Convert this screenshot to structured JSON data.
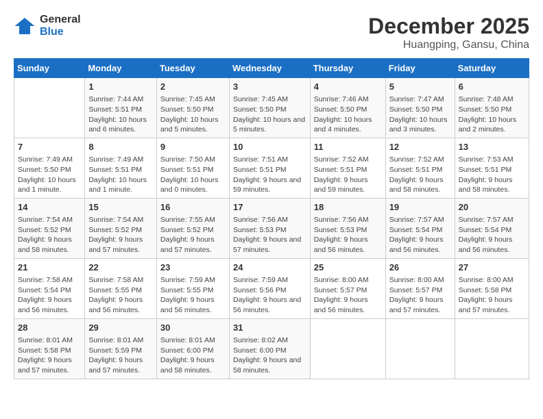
{
  "logo": {
    "general": "General",
    "blue": "Blue"
  },
  "title": {
    "month": "December 2025",
    "location": "Huangping, Gansu, China"
  },
  "days_of_week": [
    "Sunday",
    "Monday",
    "Tuesday",
    "Wednesday",
    "Thursday",
    "Friday",
    "Saturday"
  ],
  "weeks": [
    [
      {
        "day": "",
        "sunrise": "",
        "sunset": "",
        "daylight": ""
      },
      {
        "day": "1",
        "sunrise": "Sunrise: 7:44 AM",
        "sunset": "Sunset: 5:51 PM",
        "daylight": "Daylight: 10 hours and 6 minutes."
      },
      {
        "day": "2",
        "sunrise": "Sunrise: 7:45 AM",
        "sunset": "Sunset: 5:50 PM",
        "daylight": "Daylight: 10 hours and 5 minutes."
      },
      {
        "day": "3",
        "sunrise": "Sunrise: 7:45 AM",
        "sunset": "Sunset: 5:50 PM",
        "daylight": "Daylight: 10 hours and 5 minutes."
      },
      {
        "day": "4",
        "sunrise": "Sunrise: 7:46 AM",
        "sunset": "Sunset: 5:50 PM",
        "daylight": "Daylight: 10 hours and 4 minutes."
      },
      {
        "day": "5",
        "sunrise": "Sunrise: 7:47 AM",
        "sunset": "Sunset: 5:50 PM",
        "daylight": "Daylight: 10 hours and 3 minutes."
      },
      {
        "day": "6",
        "sunrise": "Sunrise: 7:48 AM",
        "sunset": "Sunset: 5:50 PM",
        "daylight": "Daylight: 10 hours and 2 minutes."
      }
    ],
    [
      {
        "day": "7",
        "sunrise": "Sunrise: 7:49 AM",
        "sunset": "Sunset: 5:50 PM",
        "daylight": "Daylight: 10 hours and 1 minute."
      },
      {
        "day": "8",
        "sunrise": "Sunrise: 7:49 AM",
        "sunset": "Sunset: 5:51 PM",
        "daylight": "Daylight: 10 hours and 1 minute."
      },
      {
        "day": "9",
        "sunrise": "Sunrise: 7:50 AM",
        "sunset": "Sunset: 5:51 PM",
        "daylight": "Daylight: 10 hours and 0 minutes."
      },
      {
        "day": "10",
        "sunrise": "Sunrise: 7:51 AM",
        "sunset": "Sunset: 5:51 PM",
        "daylight": "Daylight: 9 hours and 59 minutes."
      },
      {
        "day": "11",
        "sunrise": "Sunrise: 7:52 AM",
        "sunset": "Sunset: 5:51 PM",
        "daylight": "Daylight: 9 hours and 59 minutes."
      },
      {
        "day": "12",
        "sunrise": "Sunrise: 7:52 AM",
        "sunset": "Sunset: 5:51 PM",
        "daylight": "Daylight: 9 hours and 58 minutes."
      },
      {
        "day": "13",
        "sunrise": "Sunrise: 7:53 AM",
        "sunset": "Sunset: 5:51 PM",
        "daylight": "Daylight: 9 hours and 58 minutes."
      }
    ],
    [
      {
        "day": "14",
        "sunrise": "Sunrise: 7:54 AM",
        "sunset": "Sunset: 5:52 PM",
        "daylight": "Daylight: 9 hours and 58 minutes."
      },
      {
        "day": "15",
        "sunrise": "Sunrise: 7:54 AM",
        "sunset": "Sunset: 5:52 PM",
        "daylight": "Daylight: 9 hours and 57 minutes."
      },
      {
        "day": "16",
        "sunrise": "Sunrise: 7:55 AM",
        "sunset": "Sunset: 5:52 PM",
        "daylight": "Daylight: 9 hours and 57 minutes."
      },
      {
        "day": "17",
        "sunrise": "Sunrise: 7:56 AM",
        "sunset": "Sunset: 5:53 PM",
        "daylight": "Daylight: 9 hours and 57 minutes."
      },
      {
        "day": "18",
        "sunrise": "Sunrise: 7:56 AM",
        "sunset": "Sunset: 5:53 PM",
        "daylight": "Daylight: 9 hours and 56 minutes."
      },
      {
        "day": "19",
        "sunrise": "Sunrise: 7:57 AM",
        "sunset": "Sunset: 5:54 PM",
        "daylight": "Daylight: 9 hours and 56 minutes."
      },
      {
        "day": "20",
        "sunrise": "Sunrise: 7:57 AM",
        "sunset": "Sunset: 5:54 PM",
        "daylight": "Daylight: 9 hours and 56 minutes."
      }
    ],
    [
      {
        "day": "21",
        "sunrise": "Sunrise: 7:58 AM",
        "sunset": "Sunset: 5:54 PM",
        "daylight": "Daylight: 9 hours and 56 minutes."
      },
      {
        "day": "22",
        "sunrise": "Sunrise: 7:58 AM",
        "sunset": "Sunset: 5:55 PM",
        "daylight": "Daylight: 9 hours and 56 minutes."
      },
      {
        "day": "23",
        "sunrise": "Sunrise: 7:59 AM",
        "sunset": "Sunset: 5:55 PM",
        "daylight": "Daylight: 9 hours and 56 minutes."
      },
      {
        "day": "24",
        "sunrise": "Sunrise: 7:59 AM",
        "sunset": "Sunset: 5:56 PM",
        "daylight": "Daylight: 9 hours and 56 minutes."
      },
      {
        "day": "25",
        "sunrise": "Sunrise: 8:00 AM",
        "sunset": "Sunset: 5:57 PM",
        "daylight": "Daylight: 9 hours and 56 minutes."
      },
      {
        "day": "26",
        "sunrise": "Sunrise: 8:00 AM",
        "sunset": "Sunset: 5:57 PM",
        "daylight": "Daylight: 9 hours and 57 minutes."
      },
      {
        "day": "27",
        "sunrise": "Sunrise: 8:00 AM",
        "sunset": "Sunset: 5:58 PM",
        "daylight": "Daylight: 9 hours and 57 minutes."
      }
    ],
    [
      {
        "day": "28",
        "sunrise": "Sunrise: 8:01 AM",
        "sunset": "Sunset: 5:58 PM",
        "daylight": "Daylight: 9 hours and 57 minutes."
      },
      {
        "day": "29",
        "sunrise": "Sunrise: 8:01 AM",
        "sunset": "Sunset: 5:59 PM",
        "daylight": "Daylight: 9 hours and 57 minutes."
      },
      {
        "day": "30",
        "sunrise": "Sunrise: 8:01 AM",
        "sunset": "Sunset: 6:00 PM",
        "daylight": "Daylight: 9 hours and 58 minutes."
      },
      {
        "day": "31",
        "sunrise": "Sunrise: 8:02 AM",
        "sunset": "Sunset: 6:00 PM",
        "daylight": "Daylight: 9 hours and 58 minutes."
      },
      {
        "day": "",
        "sunrise": "",
        "sunset": "",
        "daylight": ""
      },
      {
        "day": "",
        "sunrise": "",
        "sunset": "",
        "daylight": ""
      },
      {
        "day": "",
        "sunrise": "",
        "sunset": "",
        "daylight": ""
      }
    ]
  ]
}
